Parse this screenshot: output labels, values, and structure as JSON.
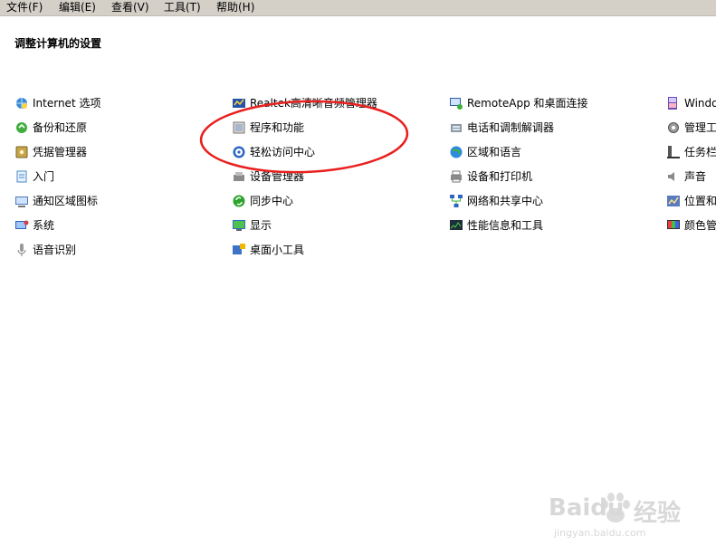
{
  "menu": [
    {
      "label": "文件(F)",
      "name": "menu-file"
    },
    {
      "label": "编辑(E)",
      "name": "menu-edit"
    },
    {
      "label": "查看(V)",
      "name": "menu-view"
    },
    {
      "label": "工具(T)",
      "name": "menu-tools"
    },
    {
      "label": "帮助(H)",
      "name": "menu-help"
    }
  ],
  "title": "调整计算机的设置",
  "columns": [
    [
      {
        "label": "Internet 选项",
        "icon": "internet-options-icon"
      },
      {
        "label": "备份和还原",
        "icon": "backup-restore-icon"
      },
      {
        "label": "凭据管理器",
        "icon": "credential-manager-icon"
      },
      {
        "label": "入门",
        "icon": "getting-started-icon"
      },
      {
        "label": "通知区域图标",
        "icon": "notification-area-icon"
      },
      {
        "label": "系统",
        "icon": "system-icon"
      },
      {
        "label": "语音识别",
        "icon": "speech-recognition-icon"
      }
    ],
    [
      {
        "label": "Realtek高清晰音频管理器",
        "icon": "realtek-audio-icon"
      },
      {
        "label": "程序和功能",
        "icon": "programs-features-icon"
      },
      {
        "label": "轻松访问中心",
        "icon": "ease-of-access-icon"
      },
      {
        "label": "设备管理器",
        "icon": "device-manager-icon"
      },
      {
        "label": "同步中心",
        "icon": "sync-center-icon"
      },
      {
        "label": "显示",
        "icon": "display-icon"
      },
      {
        "label": "桌面小工具",
        "icon": "desktop-gadgets-icon"
      }
    ],
    [
      {
        "label": "RemoteApp 和桌面连接",
        "icon": "remoteapp-icon"
      },
      {
        "label": "电话和调制解调器",
        "icon": "phone-modem-icon"
      },
      {
        "label": "区域和语言",
        "icon": "region-language-icon"
      },
      {
        "label": "设备和打印机",
        "icon": "devices-printers-icon"
      },
      {
        "label": "网络和共享中心",
        "icon": "network-sharing-icon"
      },
      {
        "label": "性能信息和工具",
        "icon": "performance-icon"
      }
    ],
    [
      {
        "label": "Window",
        "icon": "windows-cardspace-icon"
      },
      {
        "label": "管理工",
        "icon": "admin-tools-icon"
      },
      {
        "label": "任务栏",
        "icon": "taskbar-icon"
      },
      {
        "label": "声音",
        "icon": "sound-icon"
      },
      {
        "label": "位置和",
        "icon": "location-icon"
      },
      {
        "label": "颜色管",
        "icon": "color-management-icon"
      }
    ]
  ],
  "watermark": {
    "brand": "Baidu",
    "cn": "经验",
    "url": "jingyan.baidu.com"
  },
  "colors": {
    "menubar": "#d4d0c8",
    "annotation": "#e8201e",
    "watermark": "#d8d8d8"
  }
}
